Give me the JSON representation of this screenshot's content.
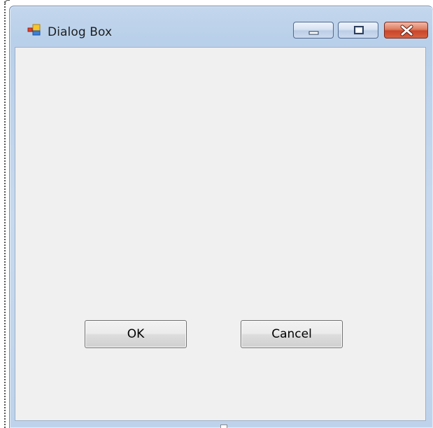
{
  "window": {
    "title": "Dialog Box",
    "caption_buttons": {
      "minimize_icon": "minimize-icon",
      "maximize_icon": "maximize-icon",
      "close_icon": "close-icon"
    }
  },
  "buttons": {
    "ok_label": "OK",
    "cancel_label": "Cancel"
  },
  "icons": {
    "app_icon": "form-icon"
  },
  "colors": {
    "client_background": "#f0f0f0",
    "title_bar": "#c3d6ec",
    "close_button": "#c9452b"
  }
}
